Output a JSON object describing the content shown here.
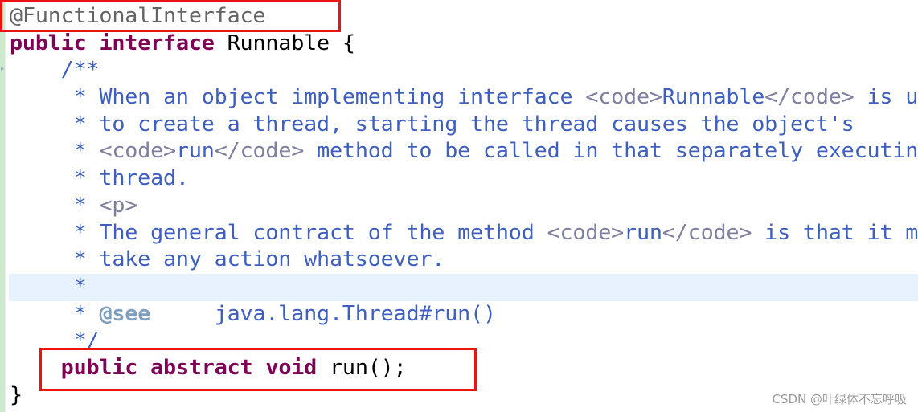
{
  "editor": {
    "language": "java",
    "highlighted_line_index": 10,
    "lines": [
      {
        "indent": "",
        "tokens": [
          {
            "t": "@FunctionalInterface",
            "c": "ann"
          }
        ]
      },
      {
        "indent": "",
        "tokens": [
          {
            "t": "public",
            "c": "kw"
          },
          {
            "t": " ",
            "c": "plain"
          },
          {
            "t": "interface",
            "c": "kw"
          },
          {
            "t": " Runnable {",
            "c": "plain"
          }
        ]
      },
      {
        "indent": "    ",
        "tokens": [
          {
            "t": "/**",
            "c": "doc"
          }
        ]
      },
      {
        "indent": "     ",
        "tokens": [
          {
            "t": "* When an object implementing interface ",
            "c": "doc"
          },
          {
            "t": "<code>",
            "c": "tag"
          },
          {
            "t": "Runnable",
            "c": "doc"
          },
          {
            "t": "</code>",
            "c": "tag"
          },
          {
            "t": " is used",
            "c": "doc"
          }
        ]
      },
      {
        "indent": "     ",
        "tokens": [
          {
            "t": "* to create a thread, starting the thread causes the object's",
            "c": "doc"
          }
        ]
      },
      {
        "indent": "     ",
        "tokens": [
          {
            "t": "* ",
            "c": "doc"
          },
          {
            "t": "<code>",
            "c": "tag"
          },
          {
            "t": "run",
            "c": "doc"
          },
          {
            "t": "</code>",
            "c": "tag"
          },
          {
            "t": " method to be called in that separately executing",
            "c": "doc"
          }
        ]
      },
      {
        "indent": "     ",
        "tokens": [
          {
            "t": "* thread.",
            "c": "doc"
          }
        ]
      },
      {
        "indent": "     ",
        "tokens": [
          {
            "t": "* ",
            "c": "doc"
          },
          {
            "t": "<p>",
            "c": "tag"
          }
        ]
      },
      {
        "indent": "     ",
        "tokens": [
          {
            "t": "* The general contract of the method ",
            "c": "doc"
          },
          {
            "t": "<code>",
            "c": "tag"
          },
          {
            "t": "run",
            "c": "doc"
          },
          {
            "t": "</code>",
            "c": "tag"
          },
          {
            "t": " is that it may",
            "c": "doc"
          }
        ]
      },
      {
        "indent": "     ",
        "tokens": [
          {
            "t": "* take any action whatsoever.",
            "c": "doc"
          }
        ]
      },
      {
        "indent": "     ",
        "tokens": [
          {
            "t": "*",
            "c": "doc"
          }
        ]
      },
      {
        "indent": "     ",
        "tokens": [
          {
            "t": "* ",
            "c": "doc"
          },
          {
            "t": "@see",
            "c": "doctag"
          },
          {
            "t": "     java.lang.Thread#run()",
            "c": "doc"
          }
        ]
      },
      {
        "indent": "     ",
        "tokens": [
          {
            "t": "*/",
            "c": "doc"
          }
        ]
      },
      {
        "indent": "    ",
        "tokens": [
          {
            "t": "public",
            "c": "kw"
          },
          {
            "t": " ",
            "c": "plain"
          },
          {
            "t": "abstract",
            "c": "kw"
          },
          {
            "t": " ",
            "c": "plain"
          },
          {
            "t": "void",
            "c": "kw"
          },
          {
            "t": " run();",
            "c": "plain"
          }
        ]
      },
      {
        "indent": "",
        "tokens": [
          {
            "t": "}",
            "c": "plain"
          }
        ]
      }
    ]
  },
  "annotations": {
    "box_1_label": "@FunctionalInterface",
    "box_2_label": "public abstract void run();",
    "box_color": "#ee1111"
  },
  "watermark": "CSDN @叶绿体不忘呼吸"
}
